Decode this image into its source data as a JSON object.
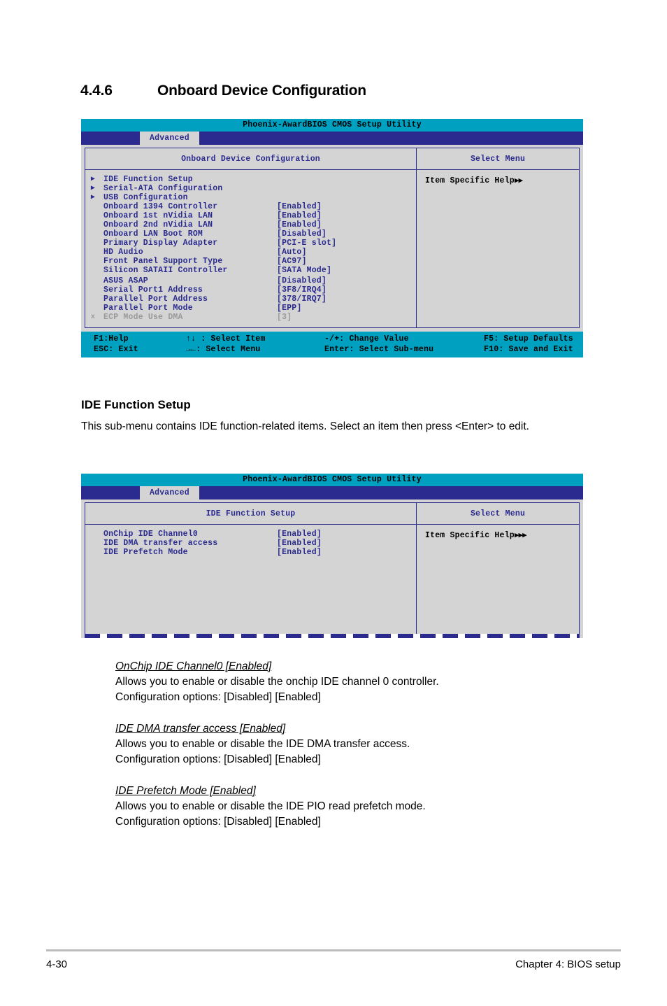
{
  "page": {
    "section_number": "4.4.6",
    "section_title": "Onboard Device Configuration",
    "footer_page": "4-30",
    "footer_chapter": "Chapter 4: BIOS setup"
  },
  "bios_common": {
    "title": "Phoenix-AwardBIOS CMOS Setup Utility",
    "tab": "Advanced",
    "select_menu": "Select Menu",
    "help_text": "Item Specific Help",
    "legend": {
      "r1c1": "F1:Help",
      "r1c2": "↑↓ : Select Item",
      "r1c3": "-/+: Change Value",
      "r1c4": "F5: Setup Defaults",
      "r2c1": "ESC: Exit",
      "r2c2": "→←: Select Menu",
      "r2c3": "Enter: Select Sub-menu",
      "r2c4": "F10: Save and Exit"
    }
  },
  "screen1": {
    "panel_title": "Onboard Device Configuration",
    "help_arrows": "▶▶",
    "items": [
      {
        "marker": "▶",
        "label": "IDE Function Setup",
        "value": "",
        "dim": false
      },
      {
        "marker": "▶",
        "label": "Serial-ATA Configuration",
        "value": "",
        "dim": false
      },
      {
        "marker": "▶",
        "label": "USB Configuration",
        "value": "",
        "dim": false
      },
      {
        "marker": "",
        "label": "Onboard 1394 Controller",
        "value": "[Enabled]",
        "dim": false
      },
      {
        "marker": "",
        "label": "Onboard 1st nVidia LAN",
        "value": "[Enabled]",
        "dim": false
      },
      {
        "marker": "",
        "label": "Onboard 2nd nVidia LAN",
        "value": "[Enabled]",
        "dim": false
      },
      {
        "marker": "",
        "label": "Onboard LAN Boot ROM",
        "value": "[Disabled]",
        "dim": false
      },
      {
        "marker": "",
        "label": "Primary Display Adapter",
        "value": "[PCI-E slot]",
        "dim": false
      },
      {
        "marker": "",
        "label": "HD Audio",
        "value": "[Auto]",
        "dim": false
      },
      {
        "marker": "",
        "label": "Front Panel Support Type",
        "value": "[AC97]",
        "dim": false
      },
      {
        "marker": "",
        "label": "Silicon SATAII Controller",
        "value": "[SATA Mode]",
        "dim": false
      },
      {
        "marker": "",
        "label": "ASUS ASAP",
        "value": "[Disabled]",
        "dim": false
      },
      {
        "marker": "",
        "label": "Serial Port1 Address",
        "value": "[3F8/IRQ4]",
        "dim": false
      },
      {
        "marker": "",
        "label": "Parallel Port Address",
        "value": "[378/IRQ7]",
        "dim": false
      },
      {
        "marker": "",
        "label": "Parallel Port Mode",
        "value": "[EPP]",
        "dim": false
      },
      {
        "marker": "x",
        "label": "ECP Mode Use DMA",
        "value": "[3]",
        "dim": true
      }
    ]
  },
  "mid_section": {
    "heading": "IDE Function Setup",
    "paragraph": "This sub-menu contains IDE function-related items. Select an item then press <Enter> to edit."
  },
  "screen2": {
    "panel_title": "IDE Function Setup",
    "help_arrows": "▶▶▶",
    "items": [
      {
        "marker": "",
        "label": "OnChip IDE Channel0",
        "value": "[Enabled]",
        "dim": false
      },
      {
        "marker": "",
        "label": "IDE DMA transfer access",
        "value": "[Enabled]",
        "dim": false
      },
      {
        "marker": "",
        "label": "IDE Prefetch Mode",
        "value": "[Enabled]",
        "dim": false
      }
    ]
  },
  "descriptions": [
    {
      "title": "OnChip IDE Channel0 [Enabled]",
      "line1": "Allows you to enable or disable the onchip IDE channel 0 controller.",
      "line2": "Configuration options: [Disabled] [Enabled]"
    },
    {
      "title": "IDE DMA transfer access [Enabled]",
      "line1": "Allows you to enable or disable the IDE DMA transfer access.",
      "line2": "Configuration options: [Disabled] [Enabled]"
    },
    {
      "title": "IDE Prefetch Mode [Enabled]",
      "line1": "Allows you to enable or disable the IDE PIO read prefetch mode.",
      "line2": "Configuration options: [Disabled] [Enabled]"
    }
  ],
  "colors": {
    "bios_title_bar": "#00a0c0",
    "bios_tab_bar": "#2b2b8f",
    "bios_panel_bg": "#d4d4d4",
    "bios_text": "#2b2b8f",
    "bios_dim_text": "#9a9a9a"
  }
}
